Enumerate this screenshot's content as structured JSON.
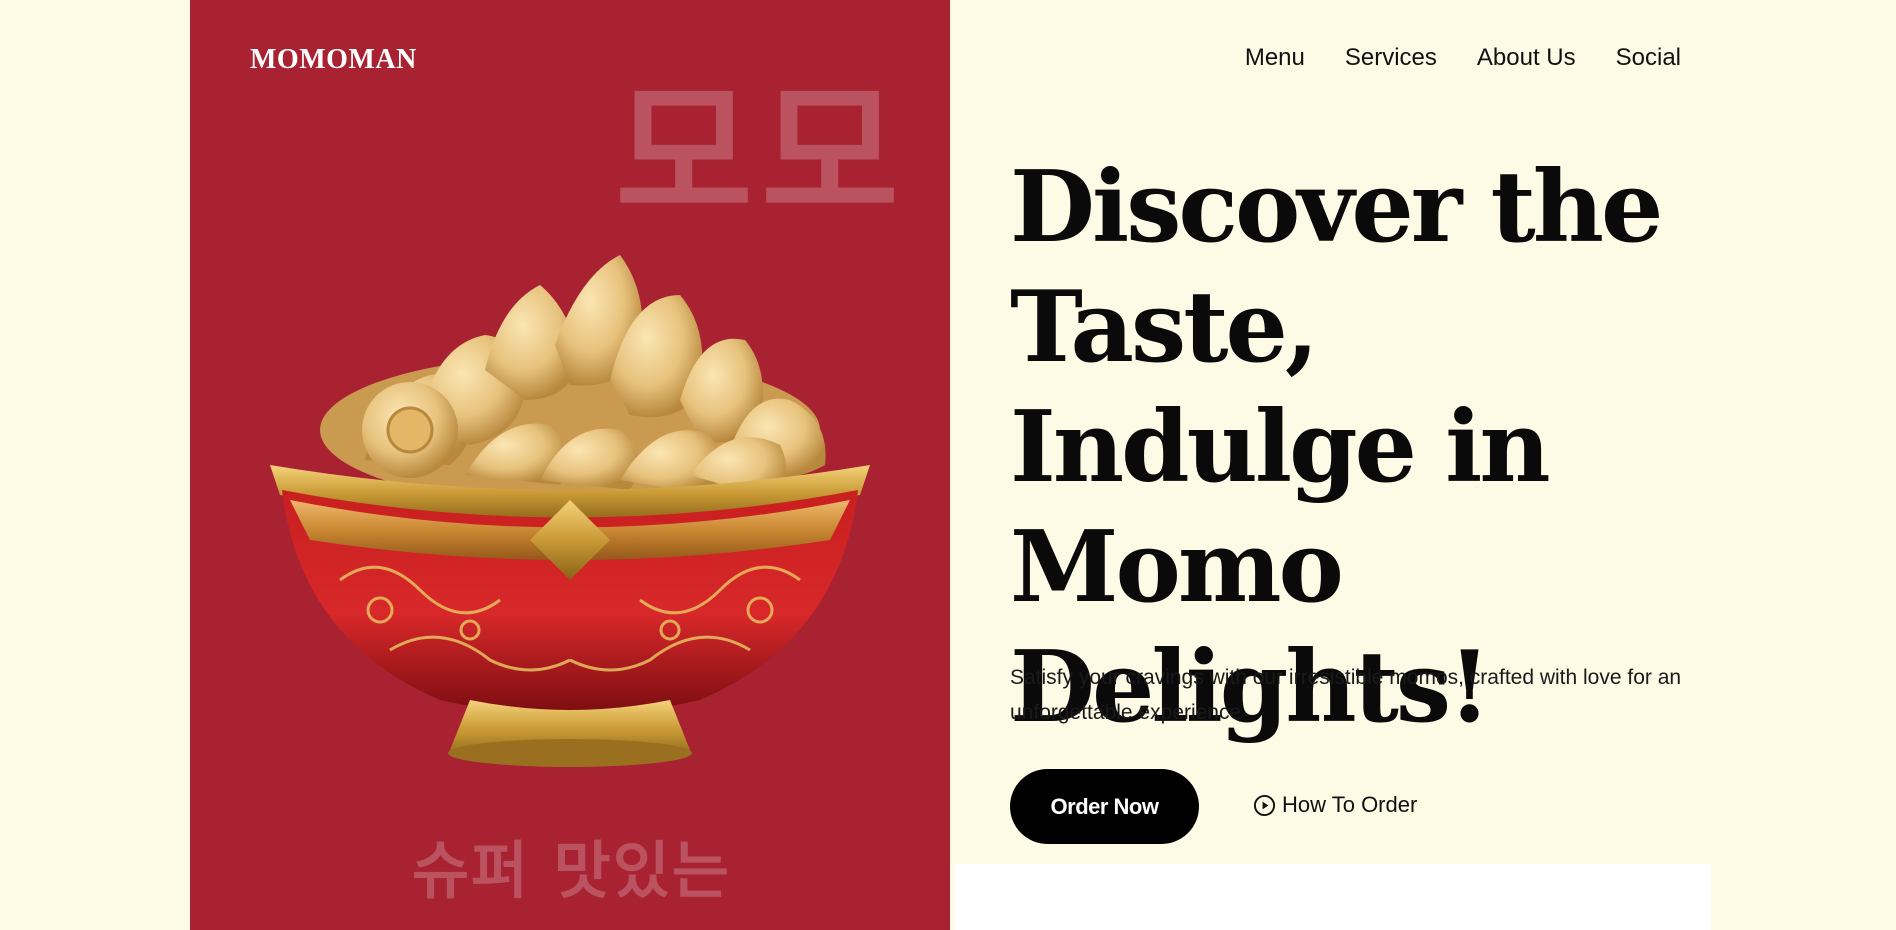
{
  "brand": {
    "logo": "MOMOMAN"
  },
  "nav": {
    "items": [
      {
        "label": "Menu"
      },
      {
        "label": "Services"
      },
      {
        "label": "About Us"
      },
      {
        "label": "Social"
      }
    ]
  },
  "decor": {
    "korean_top": "모모",
    "korean_bottom": "슈퍼 맛있는"
  },
  "hero": {
    "title": "Discover the Taste, Indulge in Momo Delights!",
    "subtitle": "Satisfy your cravings with our irresistible momos, crafted with love for an unforgettable experience",
    "order_button": "Order Now",
    "how_button": "How To Order"
  },
  "colors": {
    "panel": "#a82232",
    "background": "#fdfae6",
    "button": "#000000"
  },
  "icons": {
    "how_to_order": "play-circle-icon"
  }
}
